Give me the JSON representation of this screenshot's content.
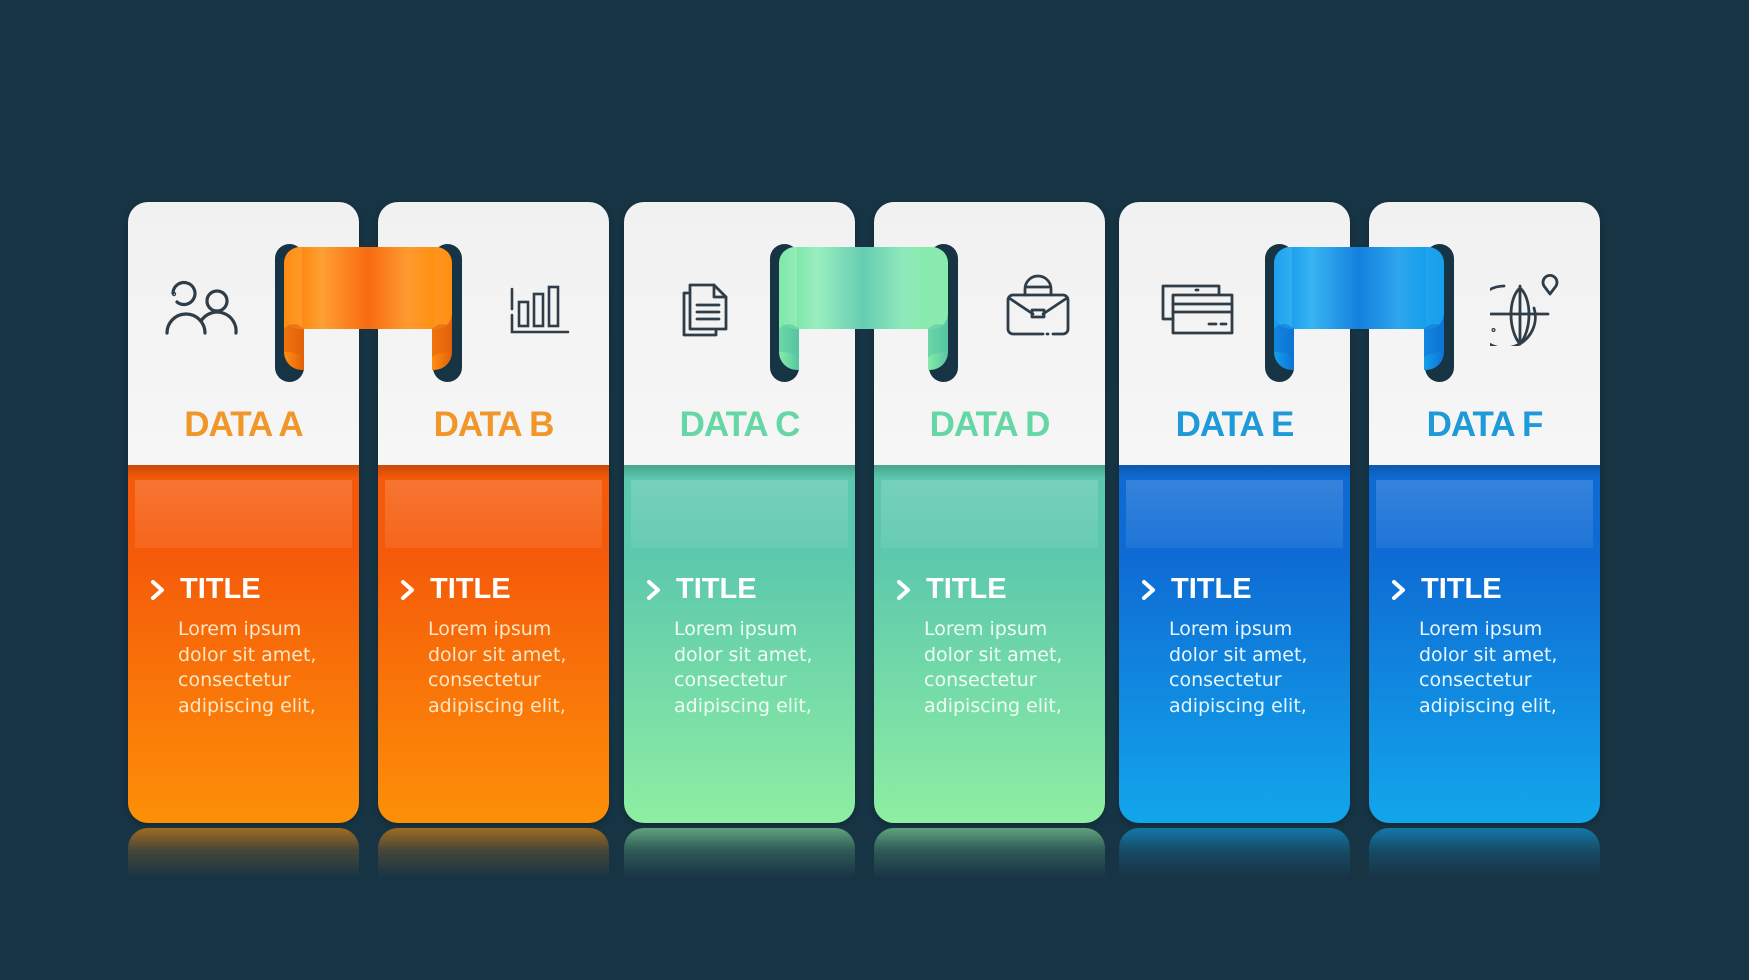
{
  "colors": {
    "background": "#173444",
    "icon": "#2e3d48",
    "orange": {
      "heading": "#f0962a",
      "top": "#f55a0a",
      "bottom": "#fd9008",
      "text": "#fde6c4"
    },
    "green": {
      "heading": "#66d6a5",
      "top": "#5cc8ad",
      "bottom": "#8eeea2",
      "text": "#eefdf4"
    },
    "blue": {
      "heading": "#1f9ad8",
      "top": "#0e6bd4",
      "bottom": "#12a6eb",
      "text": "#e6f6ff"
    }
  },
  "cards": [
    {
      "heading": "DATA A",
      "icon": "users-icon",
      "theme": "orange",
      "title": "TITLE",
      "lines": [
        "Lorem ipsum",
        "dolor sit amet,",
        "consectetur",
        "adipiscing elit,"
      ]
    },
    {
      "heading": "DATA B",
      "icon": "bar-chart-icon",
      "theme": "orange",
      "title": "TITLE",
      "lines": [
        "Lorem ipsum",
        "dolor sit amet,",
        "consectetur",
        "adipiscing elit,"
      ]
    },
    {
      "heading": "DATA C",
      "icon": "documents-icon",
      "theme": "green",
      "title": "TITLE",
      "lines": [
        "Lorem ipsum",
        "dolor sit amet,",
        "consectetur",
        "adipiscing elit,"
      ]
    },
    {
      "heading": "DATA D",
      "icon": "briefcase-icon",
      "theme": "green",
      "title": "TITLE",
      "lines": [
        "Lorem ipsum",
        "dolor sit amet,",
        "consectetur",
        "adipiscing elit,"
      ]
    },
    {
      "heading": "DATA E",
      "icon": "credit-cards-icon",
      "theme": "blue",
      "title": "TITLE",
      "lines": [
        "Lorem ipsum",
        "dolor sit amet,",
        "consectetur",
        "adipiscing elit,"
      ]
    },
    {
      "heading": "DATA F",
      "icon": "globe-location-icon",
      "theme": "blue",
      "title": "TITLE",
      "lines": [
        "Lorem ipsum",
        "dolor sit amet,",
        "consectetur",
        "adipiscing elit,"
      ]
    }
  ],
  "connectors": [
    {
      "name": "ribbon-a-b",
      "theme": "orange"
    },
    {
      "name": "ribbon-c-d",
      "theme": "green"
    },
    {
      "name": "ribbon-e-f",
      "theme": "blue"
    }
  ]
}
